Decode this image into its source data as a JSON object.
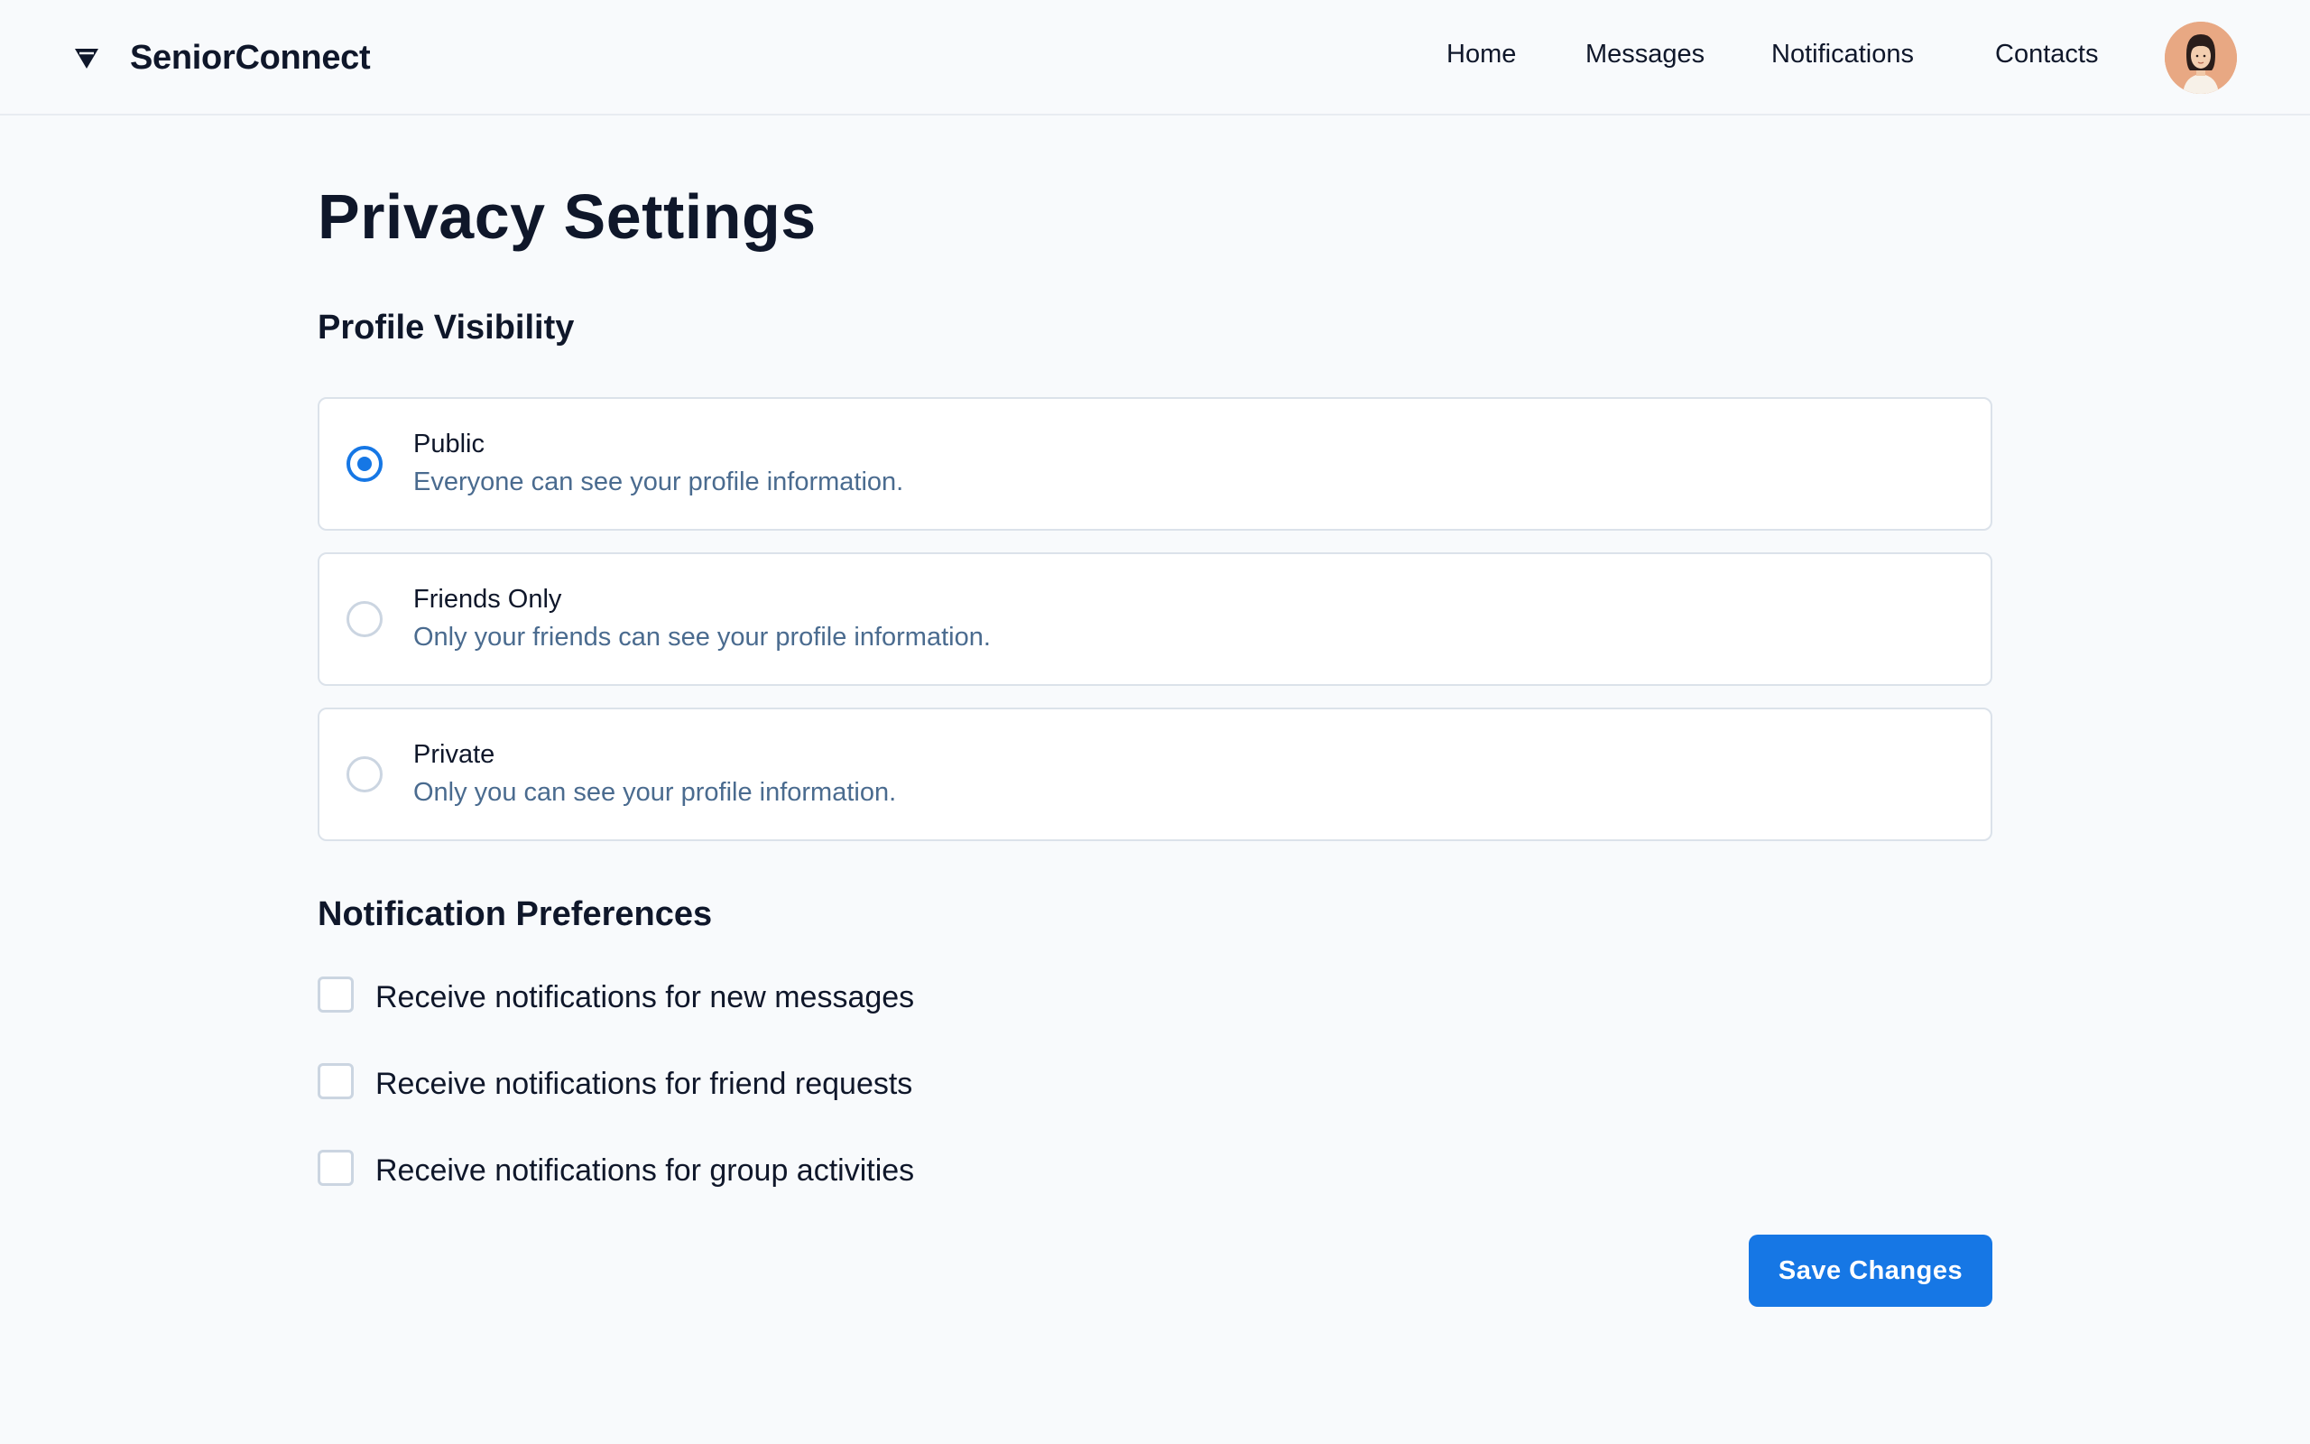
{
  "header": {
    "brand_name": "SeniorConnect",
    "brand_icon": "diamond-logo-icon",
    "nav": {
      "home": "Home",
      "messages": "Messages",
      "notifications": "Notifications",
      "contacts": "Contacts"
    },
    "avatar_icon": "user-avatar"
  },
  "page_title": "Privacy Settings",
  "profile_visibility": {
    "title": "Profile Visibility",
    "selected": "Public",
    "options": [
      {
        "label": "Public",
        "description": "Everyone can see your profile information.",
        "checked": true
      },
      {
        "label": "Friends Only",
        "description": "Only your friends can see your profile information.",
        "checked": false
      },
      {
        "label": "Private",
        "description": "Only you can see your profile information.",
        "checked": false
      }
    ]
  },
  "notification_preferences": {
    "title": "Notification Preferences",
    "items": [
      {
        "label": "Receive notifications for new messages",
        "checked": false
      },
      {
        "label": "Receive notifications for friend requests",
        "checked": false
      },
      {
        "label": "Receive notifications for group activities",
        "checked": false
      }
    ]
  },
  "save_button": "Save Changes",
  "colors": {
    "accent": "#1677e5",
    "description_text": "#4a6b8f",
    "background": "#f8fafc",
    "border": "#dbe2ea"
  }
}
